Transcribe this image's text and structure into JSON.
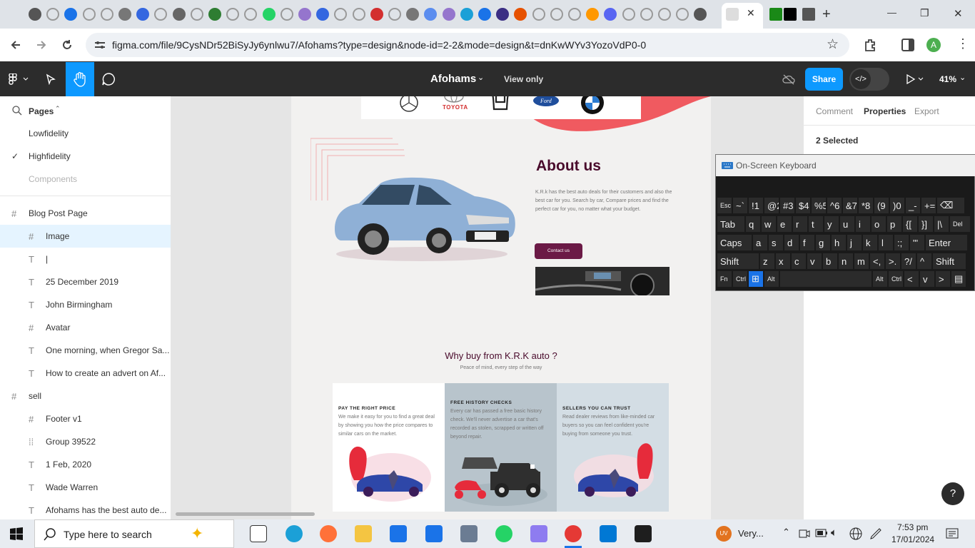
{
  "browser": {
    "url": "figma.com/file/9CysNDr52BiSyJy6ynlwu7/Afohams?type=design&node-id=2-2&mode=design&t=dnKwWYv3YozoVdP0-0",
    "tab_close": "✕",
    "new_tab": "+",
    "profile": "A",
    "win_min": "—",
    "win_max": "❐",
    "win_close": "✕"
  },
  "figma": {
    "file_name": "Afohams",
    "view_mode": "View only",
    "share_label": "Share",
    "zoom": "41%"
  },
  "left_panel": {
    "pages_label": "Pages",
    "pages": [
      {
        "label": "Lowfidelity"
      },
      {
        "label": "Highfidelity",
        "check": "✓"
      },
      {
        "label": "Components"
      }
    ],
    "layers": [
      {
        "icon": "#",
        "label": "Blog Post Page"
      },
      {
        "icon": "#",
        "label": "Image"
      },
      {
        "icon": "T",
        "label": "|"
      },
      {
        "icon": "T",
        "label": "25 December 2019"
      },
      {
        "icon": "T",
        "label": "John Birmingham"
      },
      {
        "icon": "#",
        "label": "Avatar"
      },
      {
        "icon": "T",
        "label": "One morning, when Gregor Sa..."
      },
      {
        "icon": "T",
        "label": "How to create an advert on Af..."
      },
      {
        "icon": "#",
        "label": "sell"
      },
      {
        "icon": "#",
        "label": "Footer v1"
      },
      {
        "icon": "⁞⁞",
        "label": "Group 39522"
      },
      {
        "icon": "T",
        "label": "1 Feb, 2020"
      },
      {
        "icon": "T",
        "label": "Wade Warren"
      },
      {
        "icon": "T",
        "label": "Afohams has the best auto de..."
      }
    ]
  },
  "design": {
    "brands": [
      "TOYOTA"
    ],
    "about_title": "About us",
    "about_text": "K.R.k has the best auto deals for their customers and also the best car for you. Search by car, Compare prices and find the perfect car for you, no matter what your budget.",
    "contact_label": "Contact us",
    "why_title": "Why buy from K.R.K auto ?",
    "why_sub": "Peace of mind, every step of the way",
    "cards": [
      {
        "title": "PAY THE RIGHT PRICE",
        "text": "We make it easy for you to find a great deal by showing you how the price compares to similar cars on the market."
      },
      {
        "title": "FREE HISTORY CHECKS",
        "text": "Every car has passed a free basic history check. We'll never advertise a car that's recorded as stolen, scrapped or written off beyond repair."
      },
      {
        "title": "SELLERS YOU CAN TRUST",
        "text": "Read dealer reviews from like-minded car buyers so you can feel confident you're buying from someone you trust."
      }
    ]
  },
  "right_panel": {
    "tabs": [
      "Comment",
      "Properties",
      "Export"
    ],
    "selection": "2 Selected"
  },
  "osk": {
    "title": "On-Screen Keyboard",
    "rows": [
      [
        "Esc",
        "~`",
        "!1",
        "@2",
        "#3",
        "$4",
        "%5",
        "^6",
        "&7",
        "*8",
        "(9",
        ")0",
        "_-",
        "+=",
        "⌫"
      ],
      [
        "Tab",
        "q",
        "w",
        "e",
        "r",
        "t",
        "y",
        "u",
        "i",
        "o",
        "p",
        "{[",
        "}]",
        "|\\",
        "Del"
      ],
      [
        "Caps",
        "a",
        "s",
        "d",
        "f",
        "g",
        "h",
        "j",
        "k",
        "l",
        ":;",
        "\"'",
        "Enter"
      ],
      [
        "Shift",
        "z",
        "x",
        "c",
        "v",
        "b",
        "n",
        "m",
        "<,",
        ">.",
        "?/",
        "^",
        "Shift"
      ],
      [
        "Fn",
        "Ctrl",
        "⊞",
        "Alt",
        "",
        "Alt",
        "Ctrl",
        "<",
        "v",
        ">",
        "▤"
      ]
    ]
  },
  "taskbar": {
    "search_placeholder": "Type here to search",
    "weather": "Very...",
    "time": "7:53 pm",
    "date": "17/01/2024"
  },
  "help": "?"
}
